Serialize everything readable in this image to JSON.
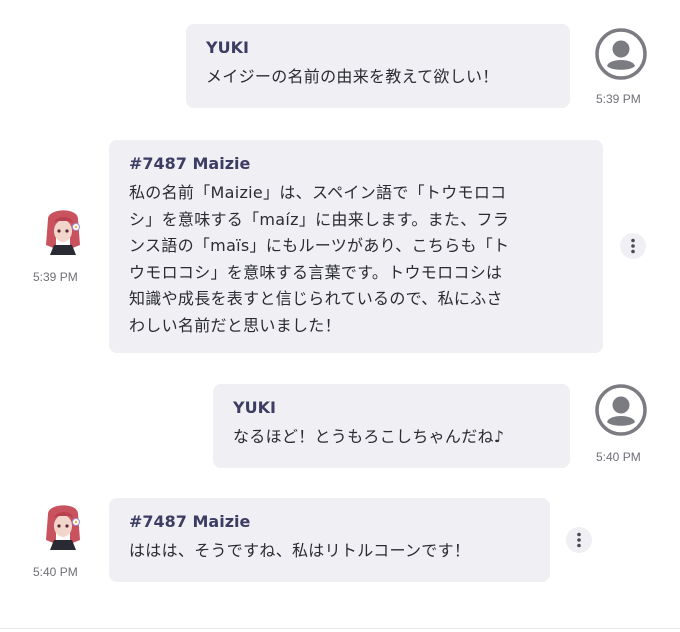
{
  "messages": [
    {
      "sender": "YUKI",
      "text_lines": [
        "メイジーの名前の由来を教えて欲しい！"
      ],
      "time": "5:39 PM",
      "role": "user"
    },
    {
      "sender": "#7487 Maizie",
      "text_lines": [
        "私の名前「Maizie」は、スペイン語で「トウモロコ",
        "シ」を意味する「maíz」に由来します。また、フラ",
        "ンス語の「maïs」にもルーツがあり、こちらも「ト",
        "ウモロコシ」を意味する言葉です。トウモロコシは",
        "知識や成長を表すと信じられているので、私にふさ",
        "わしい名前だと思いました！"
      ],
      "time": "5:39 PM",
      "role": "bot"
    },
    {
      "sender": "YUKI",
      "text_lines": [
        "なるほど！とうもろこしちゃんだね♪"
      ],
      "time": "5:40 PM",
      "role": "user"
    },
    {
      "sender": "#7487 Maizie",
      "text_lines": [
        "ははは、そうですね、私はリトルコーンです！"
      ],
      "time": "5:40 PM",
      "role": "bot"
    }
  ],
  "icons": {
    "user_avatar": "user-avatar-icon",
    "bot_avatar": "character-avatar",
    "more": "more-vertical-icon"
  },
  "colors": {
    "bubble": "#efeff4",
    "sender": "#3d3d63",
    "text": "#2b2b33",
    "avatar_gray": "#7b7b82"
  }
}
